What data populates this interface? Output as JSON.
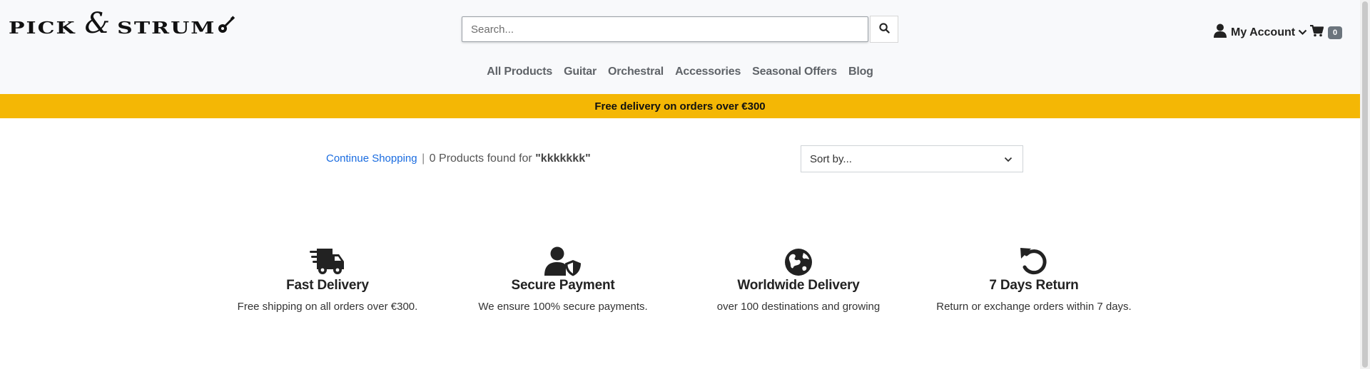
{
  "brand": {
    "word1": "PICK",
    "ampersand": "&",
    "word2": "STRUM",
    "logo_icon": "guitar-icon"
  },
  "search": {
    "placeholder": "Search...",
    "value": "",
    "button_icon": "search-icon"
  },
  "account": {
    "label": "My Account",
    "icon": "user-icon",
    "chevron_icon": "chevron-down-icon"
  },
  "cart": {
    "icon": "cart-icon",
    "count": "0"
  },
  "nav": {
    "items": [
      {
        "label": "All Products"
      },
      {
        "label": "Guitar"
      },
      {
        "label": "Orchestral"
      },
      {
        "label": "Accessories"
      },
      {
        "label": "Seasonal Offers"
      },
      {
        "label": "Blog"
      }
    ]
  },
  "promo": {
    "text": "Free delivery on orders over €300",
    "color": "#f4b705"
  },
  "results": {
    "continue_label": "Continue Shopping",
    "separator": "|",
    "summary": "0 Products found for",
    "query": "\"kkkkkkk\""
  },
  "sort": {
    "label": "Sort by...",
    "icon": "chevron-down-icon"
  },
  "features": [
    {
      "icon": "delivery-truck-icon",
      "title": "Fast Delivery",
      "desc": "Free shipping on all orders over €300."
    },
    {
      "icon": "secure-user-shield-icon",
      "title": "Secure Payment",
      "desc": "We ensure 100% secure payments."
    },
    {
      "icon": "globe-icon",
      "title": "Worldwide Delivery",
      "desc": "over 100 destinations and growing"
    },
    {
      "icon": "undo-arrow-icon",
      "title": "7 Days Return",
      "desc": "Return or exchange orders within 7 days."
    }
  ],
  "colors": {
    "header_bg": "#f8f9fb",
    "link": "#1a6ce0",
    "nav_text": "#5f6368",
    "badge_bg": "#6c757d"
  }
}
